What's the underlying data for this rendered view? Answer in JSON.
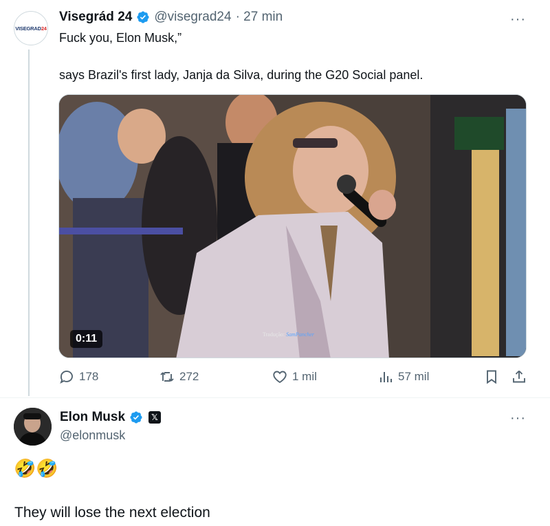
{
  "tweet": {
    "author_name": "Visegrád 24",
    "handle": "@visegrad24",
    "time": "· 27 min",
    "avatar_text_main": "VISEGRAD",
    "avatar_text_num": "24",
    "line1": "Fuck you, Elon Musk,”",
    "line2": "says Brazil's first lady, Janja da Silva, during the G20 Social panel.",
    "video": {
      "duration": "0:11",
      "caption_prefix": "Tradução:",
      "caption_name": "SamPancher"
    },
    "stats": {
      "replies": "178",
      "reposts": "272",
      "likes": "1 mil",
      "views": "57 mil"
    }
  },
  "reply": {
    "author_name": "Elon Musk",
    "handle": "@elonmusk",
    "badge": "𝕏",
    "emoji": "🤣🤣",
    "text": "They will lose the next election"
  },
  "icons": {
    "more": "···",
    "colors": {
      "verified": "#1d9bf0",
      "muted": "#536471",
      "text": "#0f1419"
    }
  }
}
